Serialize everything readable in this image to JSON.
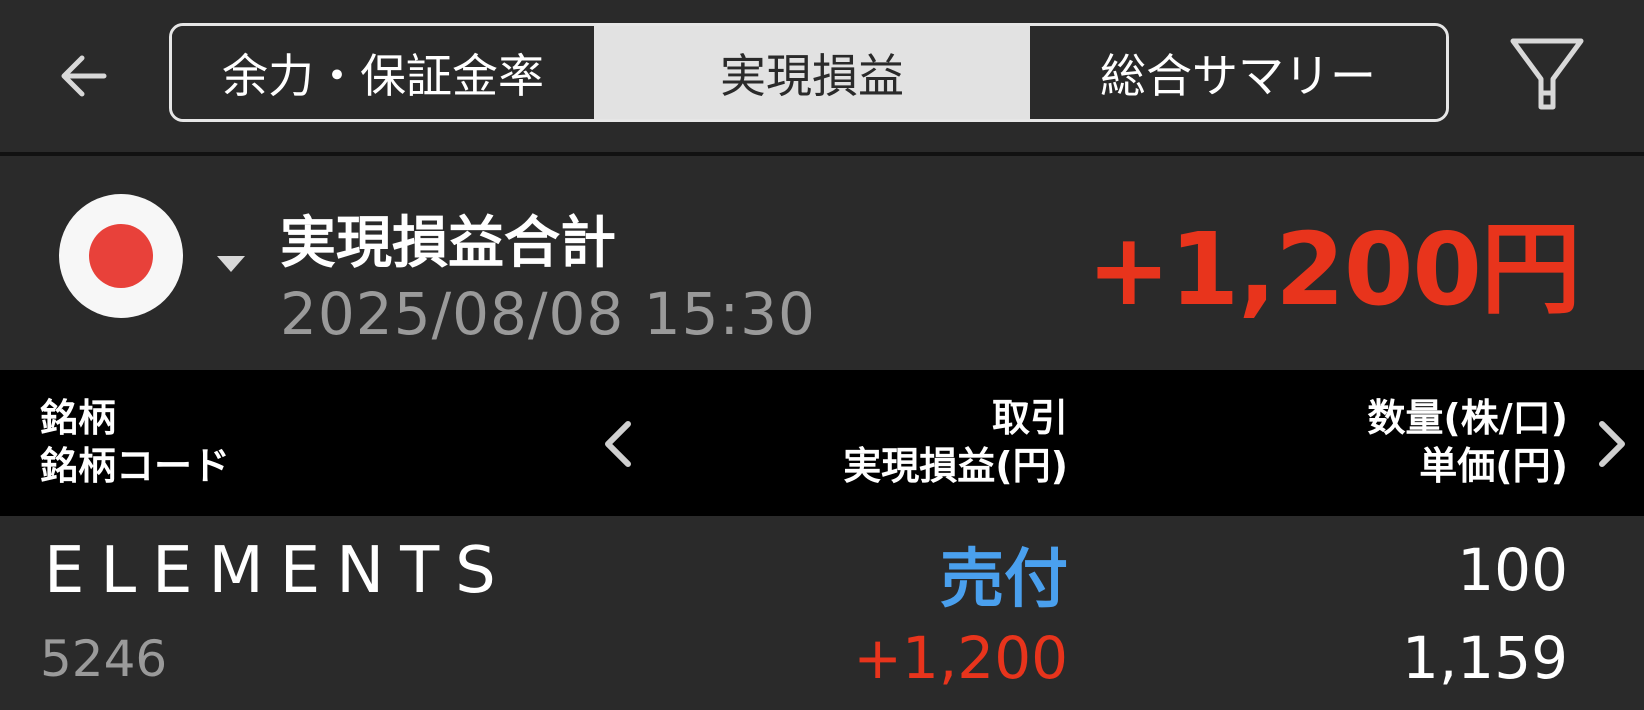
{
  "header": {
    "tabs": [
      {
        "label": "余力・保証金率",
        "active": false
      },
      {
        "label": "実現損益",
        "active": true
      },
      {
        "label": "総合サマリー",
        "active": false
      }
    ],
    "back_icon": "arrow-left-icon",
    "filter_icon": "filter-icon"
  },
  "summary": {
    "market_flag_icon": "japan-flag-icon",
    "title": "実現損益合計",
    "datetime": "2025/08/08  15:30",
    "total": "+1,200円"
  },
  "table": {
    "header": {
      "col1_line1": "銘柄",
      "col1_line2": "銘柄コード",
      "col2_line1": "取引",
      "col2_line2": "実現損益(円)",
      "col3_line1": "数量(株/口)",
      "col3_line2": "単価(円)"
    },
    "rows": [
      {
        "name": "ELEMENTS",
        "code": "5246",
        "trade": "売付",
        "realized_pl": "+1,200",
        "quantity": "100",
        "unit_price": "1,159"
      }
    ]
  },
  "colors": {
    "background": "#2a2a2a",
    "header_background": "#000000",
    "profit_red": "#e8341c",
    "sell_blue": "#4aa0ee",
    "muted_text": "#9a9a9a"
  }
}
